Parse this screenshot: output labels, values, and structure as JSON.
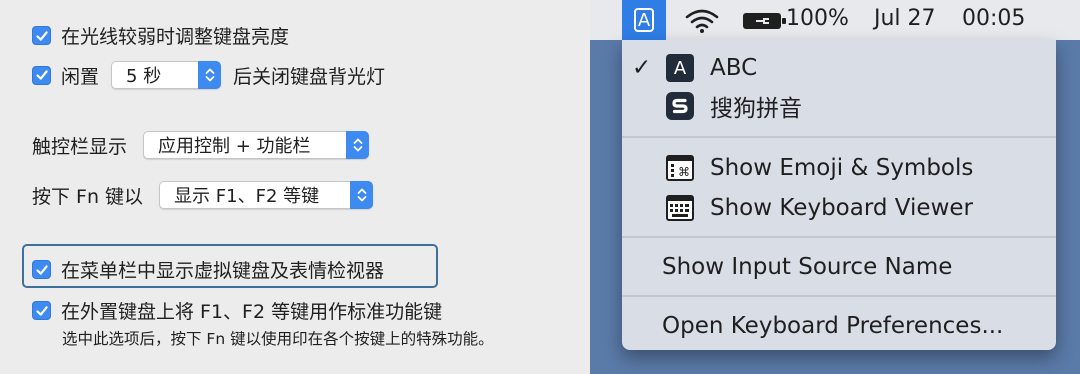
{
  "prefs": {
    "adjust_brightness_label": "在光线较弱时调整键盘亮度",
    "idle_prefix": "闲置",
    "idle_value": "5 秒",
    "idle_suffix": "后关闭键盘背光灯",
    "touchbar_label": "触控栏显示",
    "touchbar_value": "应用控制 + 功能栏",
    "fn_label": "按下 Fn 键以",
    "fn_value": "显示 F1、F2 等键",
    "show_viewer_label": "在菜单栏中显示虚拟键盘及表情检视器",
    "std_fn_label": "在外置键盘上将 F1、F2 等键用作标准功能键",
    "std_fn_note": "选中此选项后，按下 Fn 键以使用印在各个按键上的特殊功能。"
  },
  "menubar": {
    "input_letter": "A",
    "battery": "100%",
    "date": "Jul 27",
    "time": "00:05"
  },
  "menu": {
    "items": [
      {
        "label": "ABC",
        "checked": true,
        "icon": "abc-input-icon",
        "icon_letter": "A"
      },
      {
        "label": "搜狗拼音",
        "checked": false,
        "icon": "sogou-pinyin-icon"
      },
      {
        "label": "Show Emoji & Symbols",
        "icon": "emoji-symbols-icon"
      },
      {
        "label": "Show Keyboard Viewer",
        "icon": "keyboard-viewer-icon"
      },
      {
        "label": "Show Input Source Name"
      },
      {
        "label": "Open Keyboard Preferences..."
      }
    ],
    "check_glyph": "✓"
  },
  "colors": {
    "accent": "#3d8af0",
    "menubar_selected": "#2f7de5",
    "desktop": "#5a7aa8",
    "menu_bg": "#d9dde5",
    "panel_bg": "#ececec",
    "focus_ring": "#3f6f9c"
  }
}
